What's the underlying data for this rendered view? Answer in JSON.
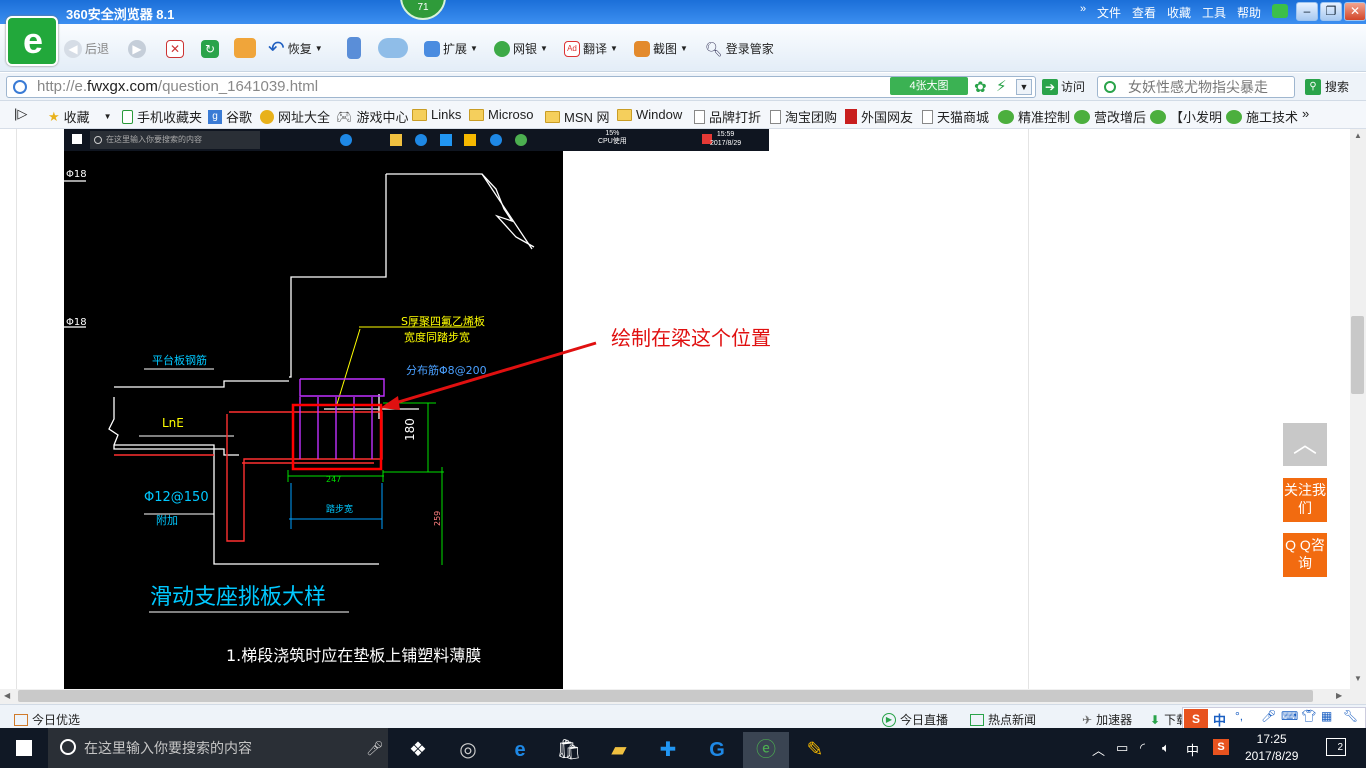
{
  "window": {
    "title": "360安全浏览器 8.1",
    "badge": "71",
    "menu": [
      "文件",
      "查看",
      "收藏",
      "工具",
      "帮助"
    ]
  },
  "toolbar": {
    "back": "后退",
    "restore": "恢复",
    "extend": "扩展",
    "bank": "网银",
    "translate": "翻译",
    "screenshot": "截图",
    "login": "登录管家"
  },
  "address": {
    "url_prefix": "http://e.",
    "url_domain": "fwxgx.com",
    "url_path": "/question_1641039.html",
    "big_pic": "4张大图",
    "visit": "访问",
    "search_placeholder": "女妖性感尤物指尖暴走",
    "search_btn": "搜索"
  },
  "favorites": [
    "收藏",
    "手机收藏夹",
    "谷歌",
    "网址大全",
    "游戏中心",
    "Links",
    "Microso",
    "MSN 网",
    "Window",
    "品牌打折",
    "淘宝团购",
    "外国网友",
    "天猫商城",
    "精准控制",
    "营改增后",
    "【小发明",
    "施工技术"
  ],
  "screenshot_taskbar": {
    "search": "在这里输入你要搜索的内容",
    "cpu": "15%",
    "cpu_label": "CPU使用",
    "time": "15:59",
    "date": "2017/8/29"
  },
  "drawing": {
    "label_s": "S厚聚四氟乙烯板",
    "label_s2": "宽度同踏步宽",
    "dist_bar": "分布筋Φ8@200",
    "platform": "平台板钢筋",
    "lne": "LnE",
    "phi12": "Φ12@150",
    "attach": "附加",
    "dim180": "180",
    "dim247": "247",
    "stepw": "踏步宽",
    "dim259": "259",
    "phi18a": "Φ18",
    "phi18b": "Φ18",
    "title": "滑动支座挑板大样",
    "note": "1.梯段浇筑时应在垫板上铺塑料薄膜"
  },
  "annotation": {
    "text": "绘制在梁这个位置",
    "color": "#e01010"
  },
  "side": {
    "follow": "关注我们",
    "qq": "Q Q咨询"
  },
  "status": {
    "today": "今日优选",
    "live": "今日直播",
    "hot": "热点新闻",
    "accel": "加速器",
    "download": "下载"
  },
  "win_taskbar": {
    "search": "在这里输入你要搜索的内容",
    "ime": "中",
    "time": "17:25",
    "date": "2017/8/29",
    "notif": "2"
  }
}
